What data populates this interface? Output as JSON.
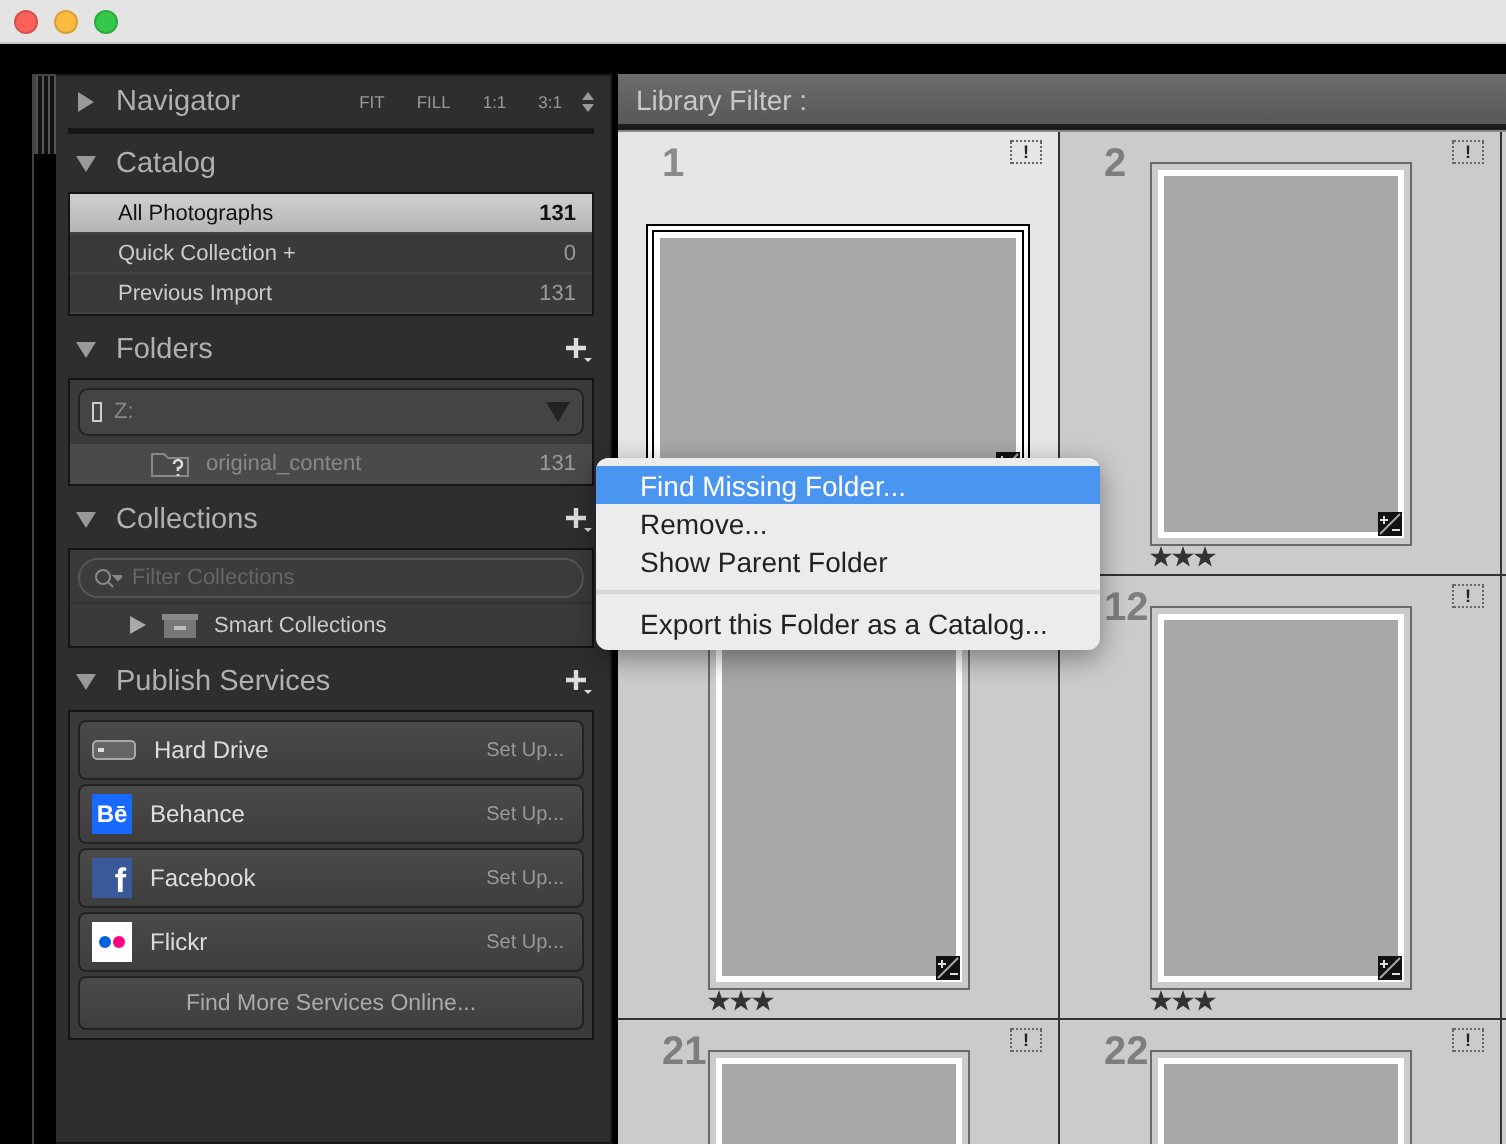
{
  "navigator": {
    "title": "Navigator",
    "expanded": false,
    "zoom_options": [
      "FIT",
      "FILL",
      "1:1",
      "3:1"
    ]
  },
  "catalog": {
    "title": "Catalog",
    "expanded": true,
    "items": [
      {
        "label": "All Photographs",
        "count": "131",
        "selected": true
      },
      {
        "label": "Quick Collection +",
        "count": "0",
        "selected": false
      },
      {
        "label": "Previous Import",
        "count": "131",
        "selected": false
      }
    ]
  },
  "folders": {
    "title": "Folders",
    "expanded": true,
    "volume": "Z:",
    "items": [
      {
        "name": "original_content",
        "count": "131",
        "missing": true
      }
    ]
  },
  "collections": {
    "title": "Collections",
    "expanded": true,
    "search": {
      "placeholder": "Filter Collections"
    },
    "items": [
      {
        "label": "Smart Collections",
        "expanded": false
      }
    ]
  },
  "publish_services": {
    "title": "Publish Services",
    "expanded": true,
    "services": [
      {
        "kind": "drive",
        "label": "Hard Drive",
        "action": "Set Up..."
      },
      {
        "kind": "behance",
        "logo_text": "Bē",
        "label": "Behance",
        "action": "Set Up..."
      },
      {
        "kind": "facebook",
        "logo_text": "f",
        "label": "Facebook",
        "action": "Set Up..."
      },
      {
        "kind": "flickr",
        "label": "Flickr",
        "action": "Set Up..."
      }
    ],
    "more_button": "Find More Services Online..."
  },
  "library_filter": {
    "label": "Library Filter :"
  },
  "grid": {
    "cells": [
      {
        "number": "1",
        "badge": "!",
        "selected": true,
        "kind": "landscape",
        "adjusted": true
      },
      {
        "number": "2",
        "badge": "!",
        "selected": false,
        "kind": "portrait",
        "adjusted": true,
        "stars": 3
      },
      {
        "selected": false,
        "kind": "portrait",
        "adjusted": true,
        "stars": 3
      },
      {
        "number": "12",
        "badge": "!",
        "selected": false,
        "kind": "portrait",
        "adjusted": true,
        "stars": 3
      },
      {
        "number": "21",
        "badge": "!",
        "selected": false,
        "kind": "portrait"
      },
      {
        "number": "22",
        "badge": "!",
        "selected": false,
        "kind": "portrait"
      }
    ]
  },
  "context_menu": {
    "groups": [
      [
        {
          "label": "Find Missing Folder...",
          "selected": true
        },
        {
          "label": "Remove...",
          "selected": false
        },
        {
          "label": "Show Parent Folder",
          "selected": false
        }
      ],
      [
        {
          "label": "Export this Folder as a Catalog...",
          "selected": false
        }
      ]
    ]
  }
}
